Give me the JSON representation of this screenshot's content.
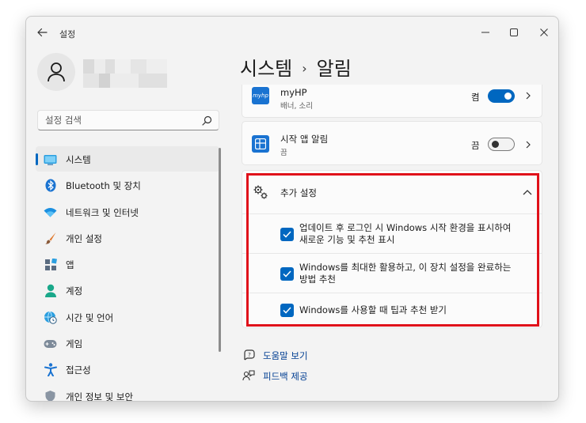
{
  "window": {
    "app_title": "설정"
  },
  "sidebar": {
    "search_placeholder": "설정 검색",
    "items": [
      {
        "label": "시스템",
        "icon": "monitor-icon",
        "active": true
      },
      {
        "label": "Bluetooth 및 장치",
        "icon": "bluetooth-icon"
      },
      {
        "label": "네트워크 및 인터넷",
        "icon": "wifi-icon"
      },
      {
        "label": "개인 설정",
        "icon": "brush-icon"
      },
      {
        "label": "앱",
        "icon": "apps-icon"
      },
      {
        "label": "계정",
        "icon": "person-icon"
      },
      {
        "label": "시간 및 언어",
        "icon": "globe-clock-icon"
      },
      {
        "label": "게임",
        "icon": "gamepad-icon"
      },
      {
        "label": "접근성",
        "icon": "accessibility-icon"
      },
      {
        "label": "개인 정보 및 보안",
        "icon": "shield-icon"
      }
    ]
  },
  "main": {
    "breadcrumb_parent": "시스템",
    "breadcrumb_separator": "›",
    "breadcrumb_current": "알림",
    "apps": [
      {
        "name": "myHP",
        "subtitle": "배너, 소리",
        "toggle_label": "켬",
        "toggle_on": true,
        "icon_text": "myhp"
      },
      {
        "name": "시작 앱 알림",
        "subtitle": "끔",
        "toggle_label": "끔",
        "toggle_on": false
      }
    ],
    "extra_settings": {
      "title": "추가 설정",
      "options": [
        {
          "text": "업데이트 후 로그인 시 Windows 시작 환경을 표시하여 새로운 기능 및 추천 표시",
          "checked": true
        },
        {
          "text": "Windows를 최대한 활용하고, 이 장치 설정을 완료하는 방법 추천",
          "checked": true
        },
        {
          "text": "Windows를 사용할 때 팁과 추천 받기",
          "checked": true
        }
      ]
    },
    "links": {
      "help": "도움말 보기",
      "feedback": "피드백 제공"
    }
  },
  "colors": {
    "accent": "#0067c0",
    "highlight": "#e0111a"
  }
}
